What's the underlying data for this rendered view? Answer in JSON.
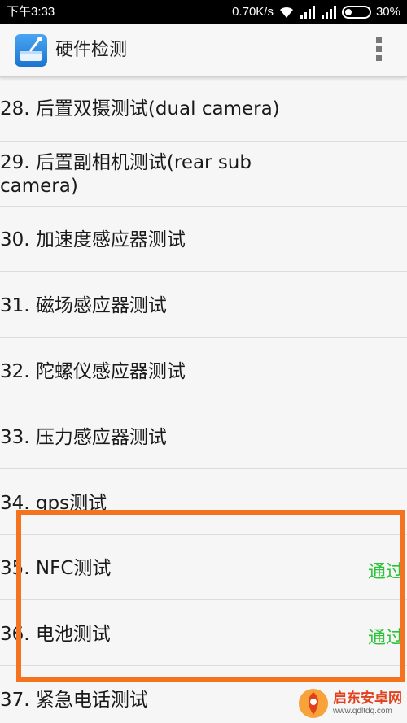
{
  "status_bar": {
    "time": "下午3:33",
    "net_speed": "0.70K/s",
    "battery": "30%"
  },
  "app_bar": {
    "title": "硬件检测",
    "icon": "hardware-test-app-icon",
    "menu_icon": "overflow-menu-icon"
  },
  "list": {
    "items": [
      {
        "label": "28. 后置双摄测试(dual camera)",
        "status": ""
      },
      {
        "label": "29. 后置副相机测试(rear sub camera)",
        "status": ""
      },
      {
        "label": "30. 加速度感应器测试",
        "status": ""
      },
      {
        "label": "31. 磁场感应器测试",
        "status": ""
      },
      {
        "label": "32. 陀螺仪感应器测试",
        "status": ""
      },
      {
        "label": "33. 压力感应器测试",
        "status": ""
      },
      {
        "label": "34. gps测试",
        "status": ""
      },
      {
        "label": "35. NFC测试",
        "status": "通过"
      },
      {
        "label": "36. 电池测试",
        "status": "通过"
      },
      {
        "label": "37. 紧急电话测试",
        "status": ""
      }
    ]
  },
  "colors": {
    "pass": "#2ec23a",
    "highlight": "#f5731f"
  },
  "watermark": {
    "name": "启东安卓网",
    "url": "www.qdltdq.com"
  }
}
